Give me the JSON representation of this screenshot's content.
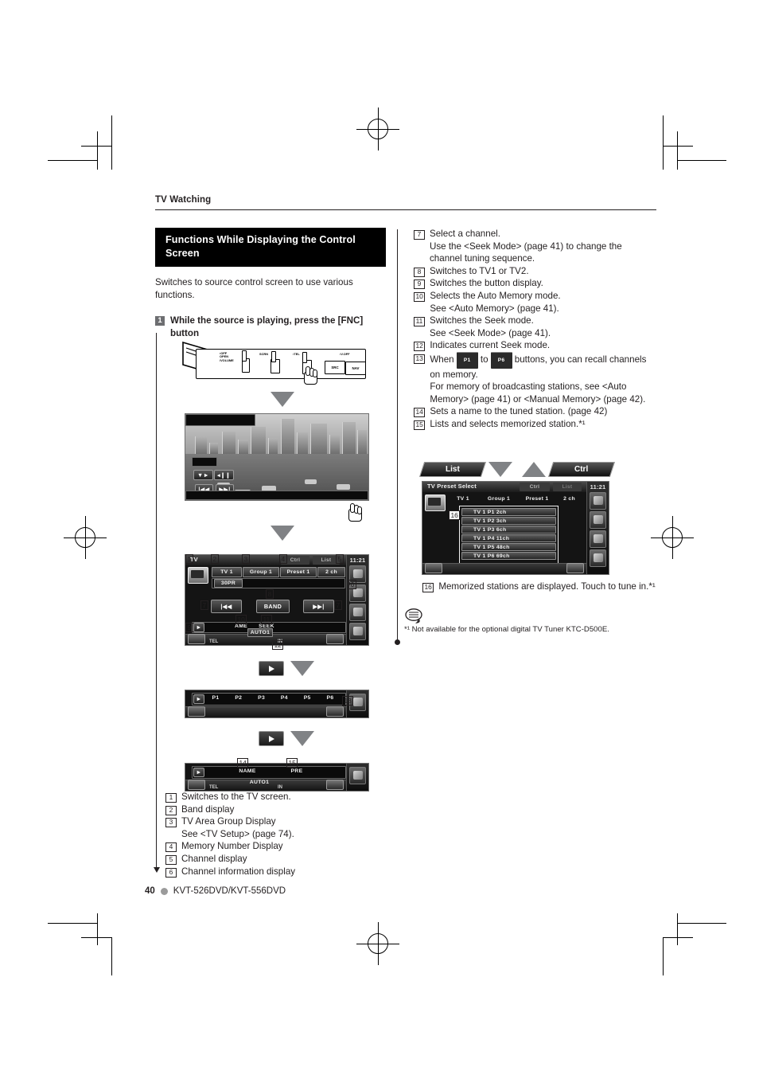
{
  "page": {
    "running_head": "TV Watching",
    "page_number": "40",
    "model": "KVT-526DVD/KVT-556DVD"
  },
  "left": {
    "section_title": "Functions While Displaying the Control Screen",
    "lead": "Switches to source control screen to use various functions.",
    "step": {
      "num": "1",
      "text": "While the source is playing, press the [FNC] button"
    },
    "refs": [
      {
        "num": "1",
        "text": "Switches to the TV screen."
      },
      {
        "num": "2",
        "text": "Band display"
      },
      {
        "num": "3",
        "text": "TV Area Group Display",
        "sub": "See <TV Setup> (page 74)."
      },
      {
        "num": "4",
        "text": "Memory Number Display"
      },
      {
        "num": "5",
        "text": "Channel display"
      },
      {
        "num": "6",
        "text": "Channel information display"
      }
    ]
  },
  "right": {
    "refs": [
      {
        "num": "7",
        "text": "Select a channel.",
        "sub": "Use the <Seek Mode> (page 41) to change the channel tuning sequence."
      },
      {
        "num": "8",
        "text": "Switches to TV1 or TV2."
      },
      {
        "num": "9",
        "text": "Switches the button display."
      },
      {
        "num": "10",
        "text": "Selects the Auto Memory mode.",
        "sub": "See <Auto Memory> (page 41)."
      },
      {
        "num": "11",
        "text": "Switches the Seek mode.",
        "sub": "See <Seek Mode> (page 41)."
      },
      {
        "num": "12",
        "text": "Indicates current Seek mode."
      }
    ],
    "ref13": {
      "num": "13",
      "pre": "When",
      "key_from": "P1",
      "mid": "to",
      "key_to": "P6",
      "post": "buttons, you can recall channels on memory.",
      "sub": "For memory of broadcasting stations, see <Auto Memory> (page 41) or <Manual Memory> (page 42)."
    },
    "refs_tail": [
      {
        "num": "14",
        "text": "Sets a name to the tuned station. (page 42)"
      },
      {
        "num": "15",
        "text": "Lists and selects memorized station.*¹"
      },
      {
        "num": "16",
        "text": "Memorized stations are displayed. Touch to tune in.*¹"
      }
    ],
    "footnote": "*¹ Not available for the optional digital TV Tuner KTC-D500E."
  },
  "tabs": {
    "list": "List",
    "ctrl": "Ctrl"
  },
  "faceplate": {
    "labels": [
      "OFF OPEN /VOLUME",
      "SCRN",
      "TEL",
      "V.OFF"
    ],
    "buttons": [
      "",
      "",
      "",
      "SRC",
      "NAV"
    ]
  },
  "tv_screen": {
    "buttons": [
      "▼►",
      "◂❙❙",
      "|◀◀",
      "▶▶|"
    ]
  },
  "control_screen": {
    "title_tab": "TV",
    "tab_ctrl": "Ctrl",
    "tab_list": "List",
    "clock": "11:21",
    "band": "TV 1",
    "group": "Group 1",
    "preset": "Preset 1",
    "channel": "2 ch",
    "info": "30PR",
    "prev_label": "|◀◀",
    "band_label": "BAND",
    "next_label": "▶▶|",
    "ame_label": "AME",
    "seek_label": "SEEK",
    "auto_label": "AUTO1",
    "tel_label": "TEL",
    "in_label": "IN",
    "callouts": [
      "1",
      "2",
      "3",
      "4",
      "5",
      "6",
      "7",
      "8",
      "9",
      "10",
      "11",
      "12"
    ]
  },
  "preset_bar": {
    "presets": [
      "P1",
      "P2",
      "P3",
      "P4",
      "P5",
      "P6"
    ],
    "callout": "13"
  },
  "name_bar": {
    "name_label": "NAME",
    "pre_label": "PRE",
    "auto_label": "AUTO1",
    "tel_label": "TEL",
    "in_label": "IN",
    "callouts": [
      "14",
      "15"
    ]
  },
  "preset_select_screen": {
    "title": "TV Preset Select",
    "tab_ctrl": "Ctrl",
    "tab_list": "List",
    "clock": "11:21",
    "band": "TV 1",
    "group": "Group 1",
    "preset": "Preset 1",
    "channel": "2 ch",
    "callout": "16",
    "items": [
      "TV 1 P1 2ch",
      "TV 1 P2 3ch",
      "TV 1 P3 6ch",
      "TV 1 P4 11ch",
      "TV 1 P5 48ch",
      "TV 1 P6 69ch"
    ]
  },
  "colors": {
    "section_bg": "#000000",
    "step_badge": "#6d6e71",
    "arrow": "#808285",
    "page_dot": "#9b9b9b"
  }
}
